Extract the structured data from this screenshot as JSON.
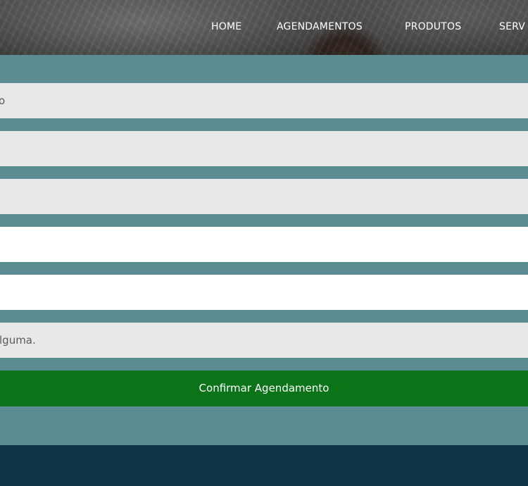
{
  "nav": {
    "items": [
      {
        "label": "HOME"
      },
      {
        "label": "AGENDAMENTOS"
      },
      {
        "label": "PRODUTOS"
      },
      {
        "label": "SERV"
      }
    ]
  },
  "form": {
    "field1_text": "o",
    "field6_text": "lguma.",
    "submit_label": "Confirmar Agendamento"
  },
  "colors": {
    "form_background": "#5b8c91",
    "input_grey": "#e8e8e9",
    "button_green": "#0b7418",
    "footer": "#0f3546"
  }
}
